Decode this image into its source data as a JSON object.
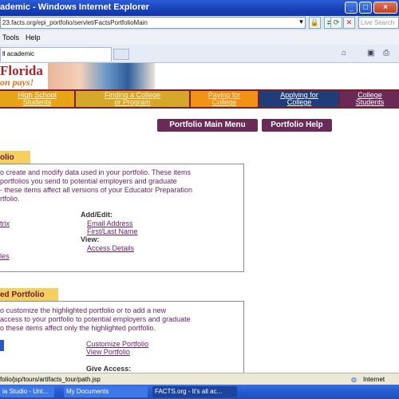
{
  "window": {
    "title": "ademic - Windows Internet Explorer",
    "buttons": [
      "_",
      "□",
      "×"
    ]
  },
  "addressbar": {
    "url": "23.facts.org/epi_portfolio/servlet/FactsPortfolioMain",
    "search_placeholder": "Live Search"
  },
  "menubar": {
    "items": [
      "Tools",
      "Help"
    ]
  },
  "tabbar": {
    "tab_label": "ll academic"
  },
  "banner": {
    "brand": "Florida",
    "tagline": "on pays!"
  },
  "nav": {
    "items": [
      {
        "line1": "High School",
        "line2": "Students",
        "bg": "#e8a417",
        "color": "#ffffff"
      },
      {
        "line1": "Finding a College",
        "line2": "or Program",
        "bg": "#d5a82a",
        "color": "#fff2cc"
      },
      {
        "line1": "Paying for",
        "line2": "College",
        "bg": "#f19216",
        "color": "#fff2cc"
      },
      {
        "line1": "Applying for",
        "line2": "College",
        "bg": "#1f3d78",
        "color": "#ffffff"
      },
      {
        "line1": "College",
        "line2": "Students",
        "bg": "#6a2a58",
        "color": "#ffffff"
      }
    ]
  },
  "buttons": {
    "main_menu": "Portfolio Main Menu",
    "help": "Portfolio Help"
  },
  "section1": {
    "header": "olio",
    "lines": [
      "o create and modify data used in your portfolio. These items",
      " portfolios you send to potential employers and graduate",
      "- these items affect all versions of your Educator Preparation",
      "rtfolio."
    ],
    "left_link1": "trix",
    "left_link2": "les",
    "addedit_label": "Add/Edit:",
    "email_link": "Email Address",
    "name_link": "First/Last Name",
    "view_label": "View:",
    "access_link": "Access Details"
  },
  "section2": {
    "header": "ed Portfolio",
    "lines": [
      "o customize the highlighted portfolio or to add a new",
      " access to your portfolio to potential employers and graduate",
      "o these items affect only the highlighted portfolio."
    ],
    "customize_link": "Customize Portfolio",
    "view_link": "View Portfolio",
    "give_access_label": "Give Access:"
  },
  "statusbar": {
    "text": "folio/jsp/tours/artifacts_tour/path.jsp",
    "zone": "Internet"
  },
  "taskbar": {
    "items": [
      "ia Studio - Unt...",
      "My Documents",
      "FACTS.org - It's all ac..."
    ]
  }
}
